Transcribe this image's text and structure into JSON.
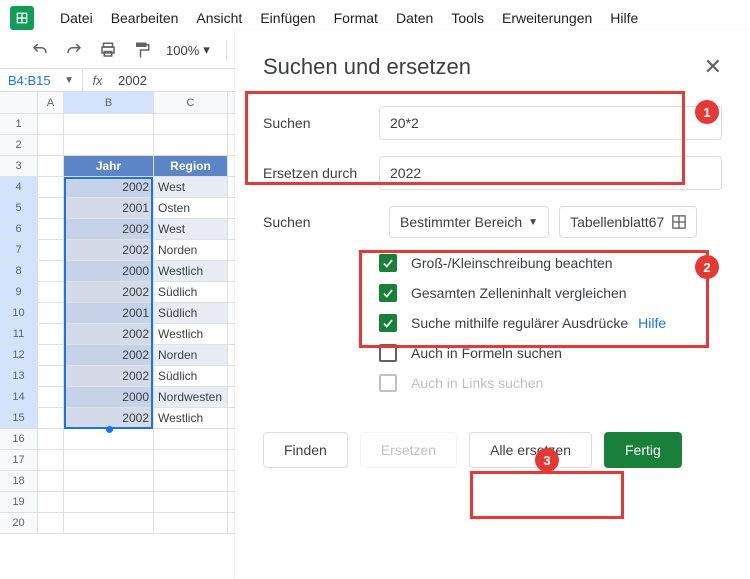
{
  "menu": [
    "Datei",
    "Bearbeiten",
    "Ansicht",
    "Einfügen",
    "Format",
    "Daten",
    "Tools",
    "Erweiterungen",
    "Hilfe"
  ],
  "zoom": "100%",
  "namebox": "B4:B15",
  "formula": "2002",
  "cols": [
    "A",
    "B",
    "C"
  ],
  "header_row": {
    "b": "Jahr",
    "c": "Region"
  },
  "rows": [
    {
      "n": "1",
      "b": "",
      "c": ""
    },
    {
      "n": "2",
      "b": "",
      "c": ""
    },
    {
      "n": "3",
      "b": "Jahr",
      "c": "Region",
      "hdr": true
    },
    {
      "n": "4",
      "b": "2002",
      "c": "West",
      "sel": true,
      "alt": true
    },
    {
      "n": "5",
      "b": "2001",
      "c": "Osten",
      "sel": true
    },
    {
      "n": "6",
      "b": "2002",
      "c": "West",
      "sel": true,
      "alt": true
    },
    {
      "n": "7",
      "b": "2002",
      "c": "Norden",
      "sel": true
    },
    {
      "n": "8",
      "b": "2000",
      "c": "Westlich",
      "sel": true,
      "alt": true
    },
    {
      "n": "9",
      "b": "2002",
      "c": "Südlich",
      "sel": true
    },
    {
      "n": "10",
      "b": "2001",
      "c": "Südlich",
      "sel": true,
      "alt": true
    },
    {
      "n": "11",
      "b": "2002",
      "c": "Westlich",
      "sel": true
    },
    {
      "n": "12",
      "b": "2002",
      "c": "Norden",
      "sel": true,
      "alt": true
    },
    {
      "n": "13",
      "b": "2002",
      "c": "Südlich",
      "sel": true
    },
    {
      "n": "14",
      "b": "2000",
      "c": "Nordwesten",
      "sel": true,
      "alt": true
    },
    {
      "n": "15",
      "b": "2002",
      "c": "Westlich",
      "sel": true
    },
    {
      "n": "16",
      "b": "",
      "c": ""
    },
    {
      "n": "17",
      "b": "",
      "c": ""
    },
    {
      "n": "18",
      "b": "",
      "c": ""
    },
    {
      "n": "19",
      "b": "",
      "c": ""
    },
    {
      "n": "20",
      "b": "",
      "c": ""
    }
  ],
  "dialog": {
    "title": "Suchen und ersetzen",
    "search_label": "Suchen",
    "search_value": "20*2",
    "replace_label": "Ersetzen durch",
    "replace_value": "2022",
    "scope_label": "Suchen",
    "scope_dropdown": "Bestimmter Bereich",
    "sheet_name": "Tabellenblatt67",
    "opt_case": "Groß-/Kleinschreibung beachten",
    "opt_entire": "Gesamten Zelleninhalt vergleichen",
    "opt_regex": "Suche mithilfe regulärer Ausdrücke",
    "help": "Hilfe",
    "opt_formulas": "Auch in Formeln suchen",
    "opt_links": "Auch in Links suchen",
    "btn_find": "Finden",
    "btn_replace": "Ersetzen",
    "btn_replace_all": "Alle ersetzen",
    "btn_done": "Fertig"
  },
  "anno": {
    "b1": "1",
    "b2": "2",
    "b3": "3"
  }
}
